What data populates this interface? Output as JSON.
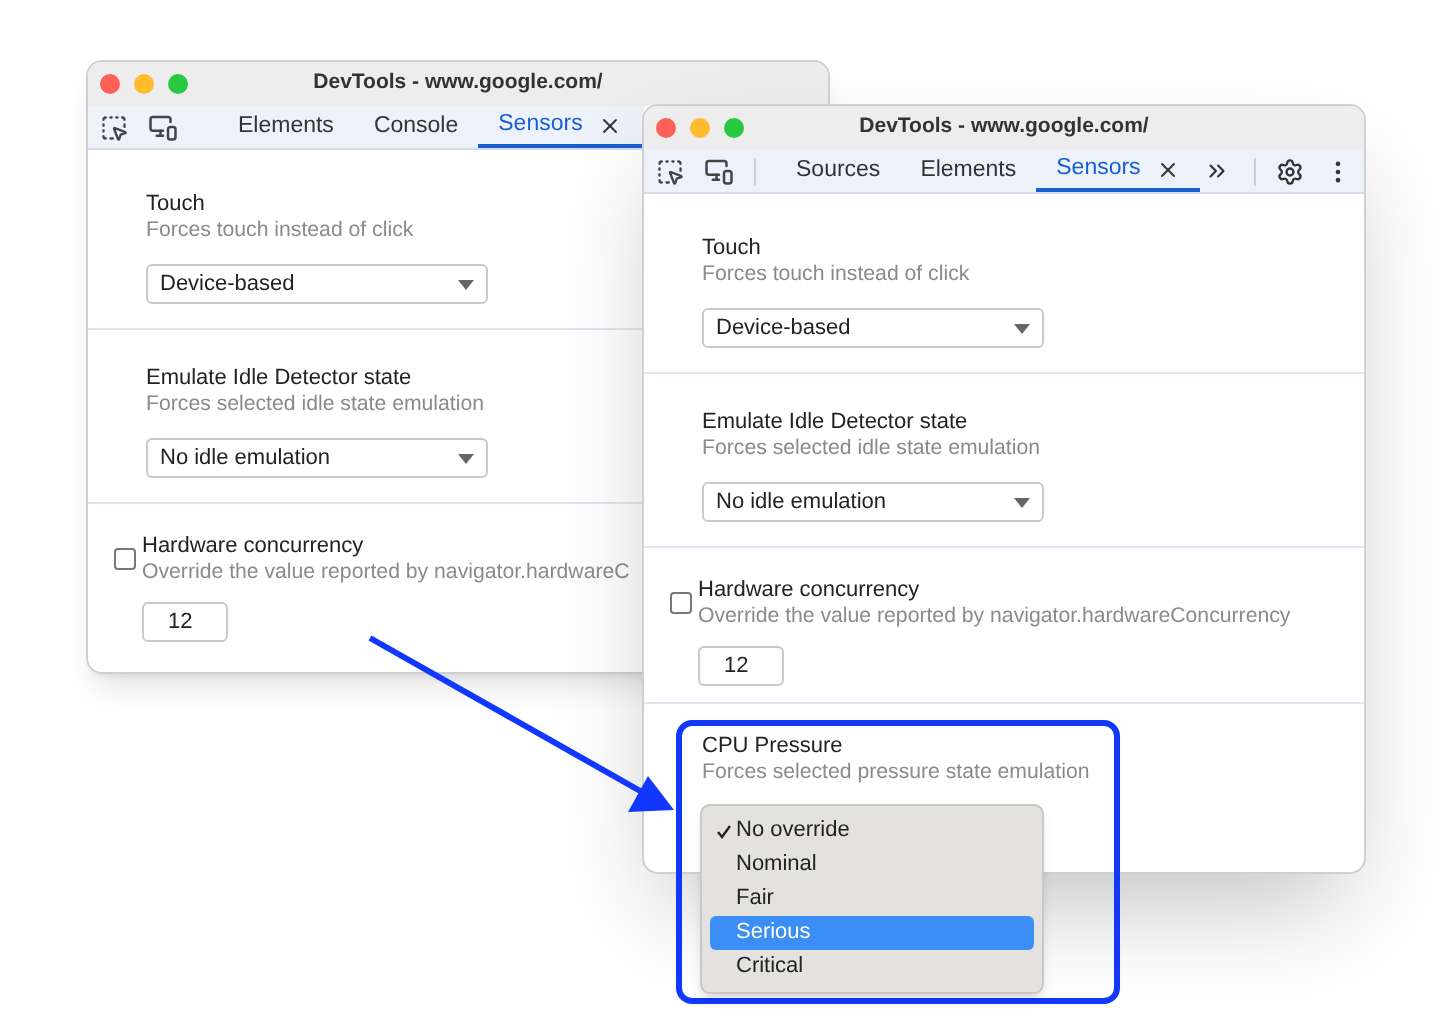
{
  "windows": [
    {
      "title": "DevTools - www.google.com/",
      "tabs": [
        {
          "label": "Elements",
          "selected": false,
          "closable": false
        },
        {
          "label": "Console",
          "selected": false,
          "closable": false
        },
        {
          "label": "Sensors",
          "selected": true,
          "closable": true
        }
      ],
      "settings": false,
      "sections": [
        {
          "kind": "select",
          "title": "Touch",
          "description": "Forces touch instead of click",
          "value": "Device-based"
        },
        {
          "kind": "select",
          "title": "Emulate Idle Detector state",
          "description": "Forces selected idle state emulation",
          "value": "No idle emulation"
        },
        {
          "kind": "number",
          "title": "Hardware concurrency",
          "description": "Override the value reported by navigator.hardwareC",
          "checked": false,
          "value": "12"
        }
      ]
    },
    {
      "title": "DevTools - www.google.com/",
      "tabs": [
        {
          "label": "Sources",
          "selected": false,
          "closable": false
        },
        {
          "label": "Elements",
          "selected": false,
          "closable": false
        },
        {
          "label": "Sensors",
          "selected": true,
          "closable": true
        }
      ],
      "settings": true,
      "sections": [
        {
          "kind": "select",
          "title": "Touch",
          "description": "Forces touch instead of click",
          "value": "Device-based"
        },
        {
          "kind": "select",
          "title": "Emulate Idle Detector state",
          "description": "Forces selected idle state emulation",
          "value": "No idle emulation"
        },
        {
          "kind": "number",
          "title": "Hardware concurrency",
          "description": "Override the value reported by navigator.hardwareConcurrency",
          "checked": false,
          "value": "12"
        },
        {
          "kind": "open-select",
          "title": "CPU Pressure",
          "description": "Forces selected pressure state emulation",
          "options": [
            {
              "label": "No override",
              "checked": true,
              "selected": false
            },
            {
              "label": "Nominal",
              "checked": false,
              "selected": false
            },
            {
              "label": "Fair",
              "checked": false,
              "selected": false
            },
            {
              "label": "Serious",
              "checked": false,
              "selected": true
            },
            {
              "label": "Critical",
              "checked": false,
              "selected": false
            }
          ]
        }
      ]
    }
  ]
}
